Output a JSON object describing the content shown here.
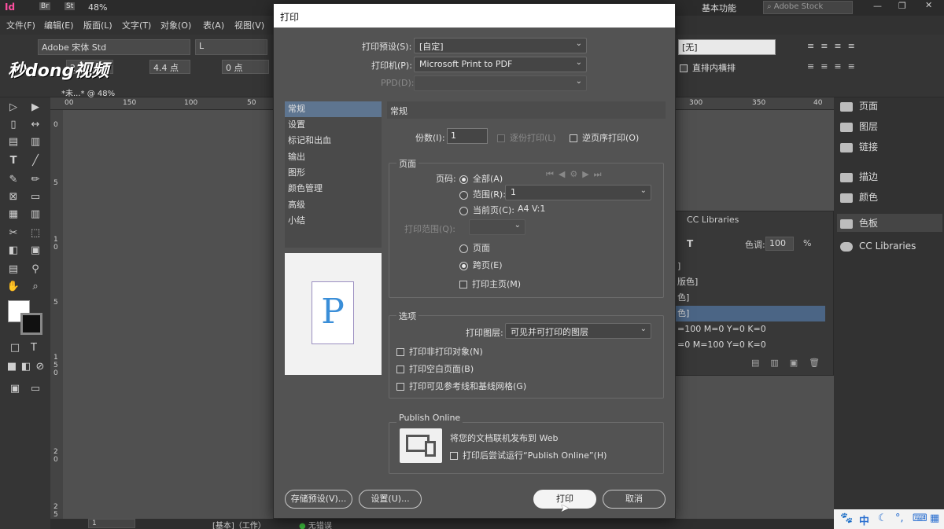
{
  "app": {
    "logo": "Id",
    "zoom": "48%",
    "workspace": "基本功能",
    "search_placeholder": "Adobe Stock",
    "watermark": "秒dong视频"
  },
  "menu": [
    "文件(F)",
    "编辑(E)",
    "版面(L)",
    "文字(T)",
    "对象(O)",
    "表(A)",
    "视图(V)"
  ],
  "controls": {
    "font": "Adobe 宋体 Std",
    "style": "L",
    "size1": "2 点",
    "size2": "4.4 点",
    "leading": "0 点",
    "none_field": "[无]",
    "vertical_label": "直排内横排"
  },
  "doc_tab": "*未...* @ 48%",
  "ruler": {
    "top": [
      "00",
      "150",
      "100",
      "50",
      "300",
      "350",
      "40"
    ],
    "left": [
      "0",
      "5",
      "1",
      "0",
      "5",
      "1",
      "5",
      "0",
      "2",
      "0",
      "2",
      "5"
    ]
  },
  "right_panel": {
    "items": [
      "页面",
      "图层",
      "链接",
      "描边",
      "颜色",
      "色板",
      "CC Libraries"
    ]
  },
  "swatches": {
    "header": "CC Libraries",
    "tint_label": "色调:",
    "tint_value": "100",
    "tint_unit": "%",
    "rows": [
      "]",
      "版色]",
      "色]",
      "色]",
      "=100 M=0 Y=0 K=0",
      "=0 M=100 Y=0 K=0"
    ]
  },
  "dialog": {
    "title": "打印",
    "preset_label": "打印预设(S):",
    "preset_value": "[自定]",
    "printer_label": "打印机(P):",
    "printer_value": "Microsoft Print to PDF",
    "ppd_label": "PPD(D):",
    "nav": [
      "常规",
      "设置",
      "标记和出血",
      "输出",
      "图形",
      "颜色管理",
      "高级",
      "小结"
    ],
    "preview_letter": "P",
    "section_general": "常规",
    "copies_label": "份数(I):",
    "copies_value": "1",
    "collate_label": "逐份打印(L)",
    "reverse_label": "逆页序打印(O)",
    "pages_group": "页面",
    "page_label": "页码:",
    "all_label": "全部(A)",
    "range_label": "范围(R):",
    "range_value": "1",
    "current_label": "当前页(C):",
    "current_value": "A4 V:1",
    "print_range_label": "打印范围(Q):",
    "pages_option": "页面",
    "spreads_option": "跨页(E)",
    "master_option": "打印主页(M)",
    "options_group": "选项",
    "layers_label": "打印图层:",
    "layers_value": "可见并可打印的图层",
    "opt_nonprint": "打印非打印对象(N)",
    "opt_blank": "打印空白页面(B)",
    "opt_guides": "打印可见参考线和基线网格(G)",
    "publish_group": "Publish Online",
    "publish_text": "将您的文档联机发布到 Web",
    "publish_check": "打印后尝试运行“Publish Online”(H)",
    "btn_save_preset": "存储预设(V)...",
    "btn_setup": "设置(U)...",
    "btn_print": "打印",
    "btn_cancel": "取消"
  },
  "status": {
    "page": "1",
    "master": "[基本]（工作）",
    "errors": "无错误"
  },
  "taskbar": [
    "中"
  ]
}
